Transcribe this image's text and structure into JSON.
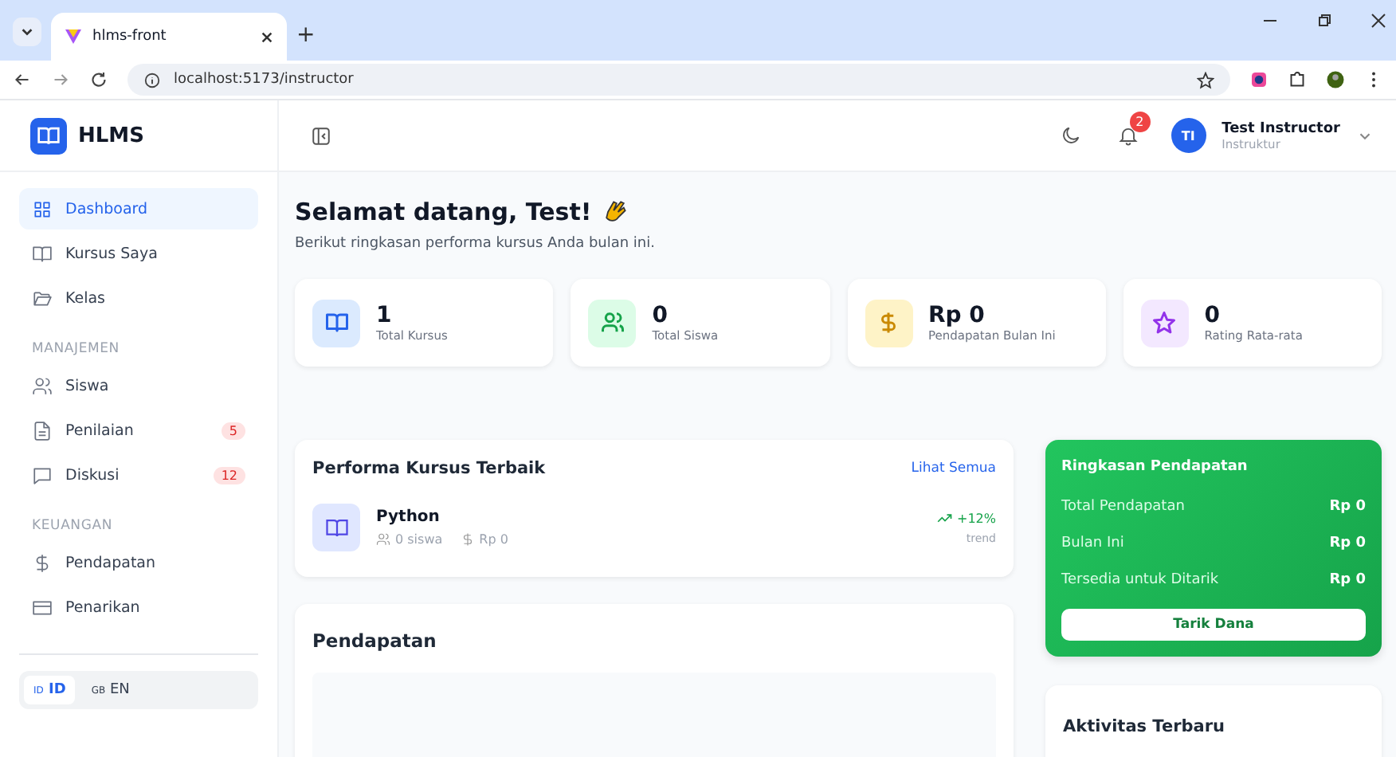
{
  "browser": {
    "tab_title": "hlms-front",
    "new_tab": "+",
    "url": "localhost:5173/instructor"
  },
  "sidebar": {
    "logo": "HLMS",
    "sections": [
      {
        "items": [
          {
            "label": "Dashboard",
            "kind": "grid",
            "selected": true
          },
          {
            "label": "Kursus Saya",
            "kind": "book",
            "selected": false
          },
          {
            "label": "Kelas",
            "kind": "folder",
            "selected": false
          }
        ]
      },
      {
        "heading": "MANAJEMEN",
        "items": [
          {
            "label": "Siswa",
            "kind": "users",
            "selected": false
          },
          {
            "label": "Penilaian",
            "kind": "file",
            "selected": false,
            "badge": "5"
          },
          {
            "label": "Diskusi",
            "kind": "chat",
            "selected": false,
            "badge": "12"
          }
        ]
      },
      {
        "heading": "KEUANGAN",
        "items": [
          {
            "label": "Pendapatan",
            "kind": "dollar",
            "selected": false
          },
          {
            "label": "Penarikan",
            "kind": "card",
            "selected": false
          }
        ]
      }
    ],
    "languages": [
      {
        "flag": "ID",
        "label": "ID",
        "selected": true
      },
      {
        "flag": "GB",
        "label": "EN",
        "selected": false
      }
    ]
  },
  "header": {
    "notifications": "2",
    "user_initials": "TI",
    "user_name": "Test Instructor",
    "user_role": "Instruktur"
  },
  "welcome": {
    "title": "Selamat datang, Test!",
    "subtitle": "Berikut ringkasan performa kursus Anda bulan ini."
  },
  "stats": [
    {
      "value": "1",
      "label": "Total Kursus",
      "kind": "book",
      "color": "#2563eb"
    },
    {
      "value": "0",
      "label": "Total Siswa",
      "kind": "users",
      "color": "#16a34a"
    },
    {
      "value": "Rp 0",
      "label": "Pendapatan Bulan Ini",
      "kind": "dollar",
      "color": "#ca8a04"
    },
    {
      "value": "0",
      "label": "Rating Rata-rata",
      "kind": "star",
      "color": "#9333ea"
    }
  ],
  "top_courses": {
    "title": "Performa Kursus Terbaik",
    "link": "Lihat Semua",
    "courses": [
      {
        "name": "Python",
        "students": "0 siswa",
        "revenue": "Rp 0",
        "trend": "+12%",
        "trend_label": "trend"
      }
    ]
  },
  "revenue": {
    "title": "Pendapatan"
  },
  "summary": {
    "title": "Ringkasan Pendapatan",
    "rows": [
      {
        "label": "Total Pendapatan",
        "value": "Rp 0"
      },
      {
        "label": "Bulan Ini",
        "value": "Rp 0"
      },
      {
        "label": "Tersedia untuk Ditarik",
        "value": "Rp 0"
      }
    ],
    "button": "Tarik Dana"
  },
  "activity": {
    "title": "Aktivitas Terbaru"
  }
}
